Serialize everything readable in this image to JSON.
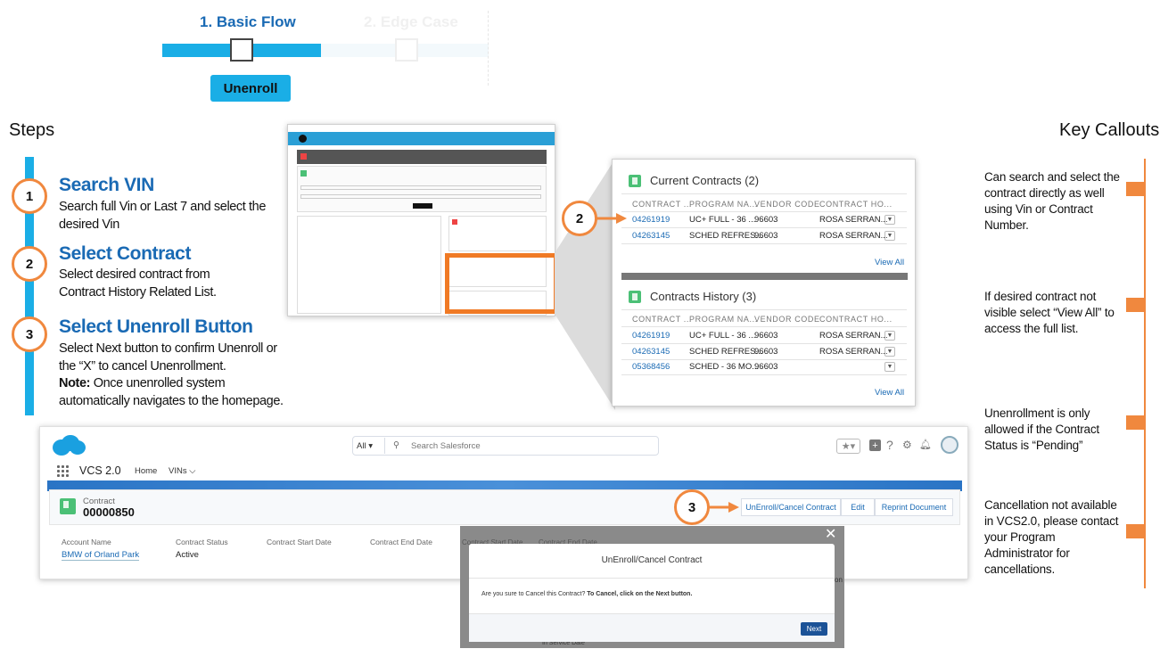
{
  "progress": {
    "step1_label": "1. Basic Flow",
    "step2_label": "2. Edge Case",
    "button_label": "Unenroll",
    "active_color": "#1aaee6",
    "inactive_color": "#eaf5fb"
  },
  "steps": {
    "title": "Steps",
    "items": [
      {
        "number": "1",
        "title": "Search VIN",
        "desc": [
          "Search full Vin or Last 7 and select the",
          "desired Vin"
        ]
      },
      {
        "number": "2",
        "title": "Select Contract",
        "desc": [
          "Select desired contract from",
          "Contract History Related List."
        ]
      },
      {
        "number": "3",
        "title": "Select Unenroll Button",
        "desc": [
          "Select Next button to confirm Unenroll or",
          "the “X” to cancel Unenrollment."
        ],
        "note_label": "Note:",
        "note_rest": " Once unenrolled system",
        "note_line2": "automatically navigates to the homepage."
      }
    ]
  },
  "callouts": {
    "title": "Key Callouts",
    "items": [
      [
        "Can search and select the",
        "contract directly as well",
        "using Vin or Contract",
        "Number."
      ],
      [
        "If desired contract not",
        "visible select “View All” to",
        "access the full list."
      ],
      [
        "Unenrollment is only",
        "allowed if the Contract",
        "Status is “Pending”"
      ],
      [
        "Cancellation not available",
        "in VCS2.0, please contact",
        "your Program",
        "Administrator for",
        "cancellations."
      ]
    ]
  },
  "contracts_panel": {
    "callout_number": "2",
    "current_title": "Current Contracts (2)",
    "history_title": "Contracts History (3)",
    "headers": [
      "CONTRACT ...",
      "PROGRAM NA...",
      "VENDOR CODE",
      "CONTRACT HO..."
    ],
    "current_rows": [
      [
        "04261919",
        "UC+ FULL - 36 ...",
        "96603",
        "ROSA SERRAN..."
      ],
      [
        "04263145",
        "SCHED REFRES...",
        "96603",
        "ROSA SERRAN..."
      ]
    ],
    "history_rows": [
      [
        "04261919",
        "UC+ FULL - 36 ...",
        "96603",
        "ROSA SERRAN..."
      ],
      [
        "04263145",
        "SCHED REFRES...",
        "96603",
        "ROSA SERRAN..."
      ],
      [
        "05368456",
        "SCHED - 36 MO...",
        "96603",
        ""
      ]
    ],
    "view_all": "View All"
  },
  "salesforce": {
    "search_scope": "All",
    "search_placeholder": "Search Salesforce",
    "app_name": "VCS 2.0",
    "nav_home": "Home",
    "nav_vins": "VINs",
    "record_type": "Contract",
    "record_number": "00000850",
    "callout_number": "3",
    "actions": [
      "UnEnroll/Cancel Contract",
      "Edit",
      "Reprint Document"
    ],
    "fields": [
      {
        "label": "Account Name",
        "value": "BMW of Orland Park"
      },
      {
        "label": "Contract Status",
        "value": "Active"
      },
      {
        "label": "Contract Start Date",
        "value": ""
      },
      {
        "label": "Contract End Date",
        "value": ""
      }
    ]
  },
  "modal": {
    "title": "UnEnroll/Cancel Contract",
    "message": "Are you sure to Cancel this Contract?",
    "message_bold": " To Cancel, click on the Next button.",
    "next_label": "Next",
    "bg_field_1": "Contract Start Date",
    "bg_field_2": "Contract End Date",
    "bg_text_bottom": "In Service Date",
    "bg_text_right": "on"
  }
}
